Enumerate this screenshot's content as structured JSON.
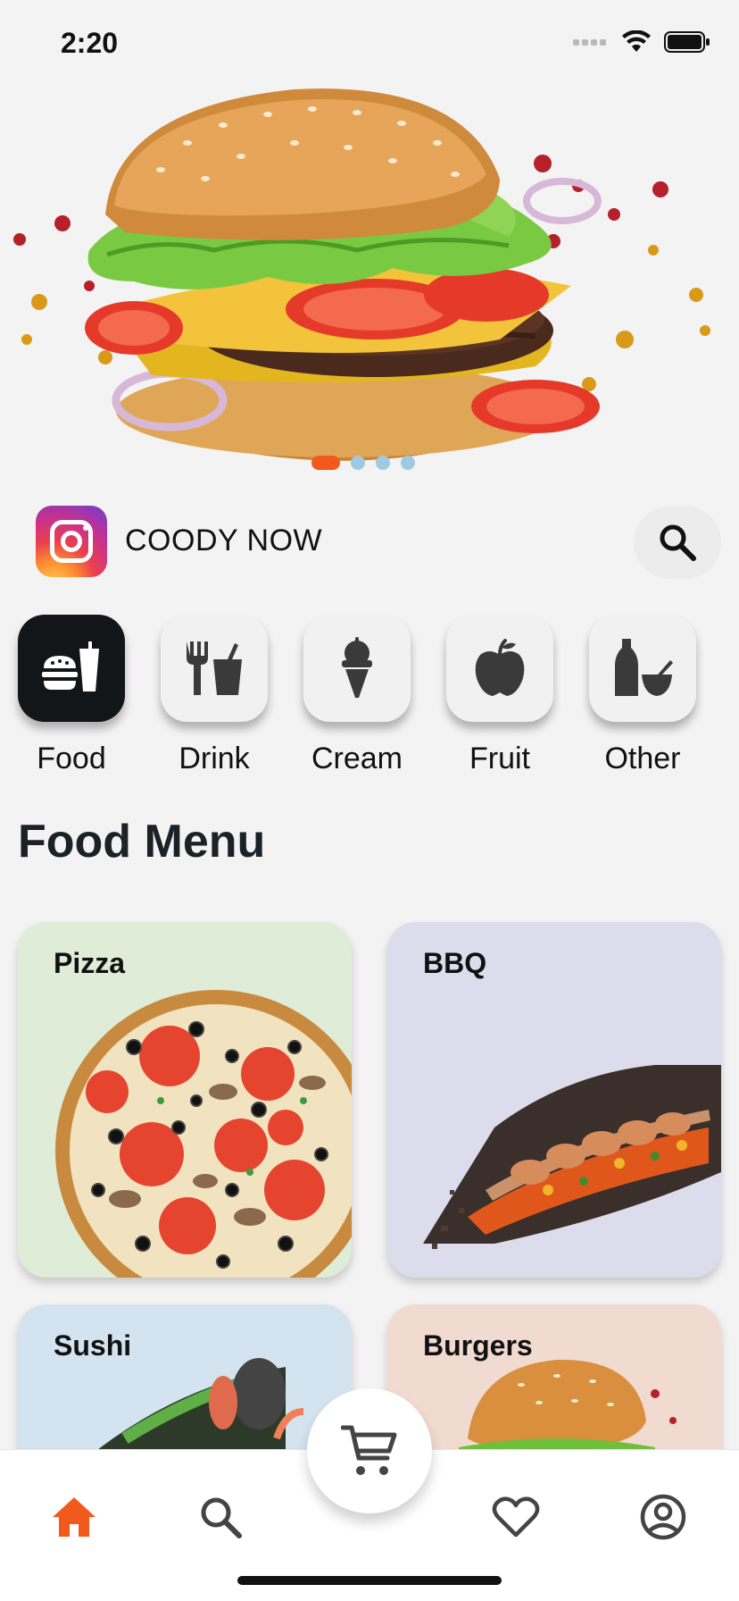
{
  "status_bar": {
    "time": "2:20"
  },
  "hero": {
    "pager_count": 4,
    "active_index": 0
  },
  "brand": {
    "name": "COODY NOW"
  },
  "categories": [
    {
      "label": "Food",
      "icon": "burger-drink-icon",
      "active": true
    },
    {
      "label": "Drink",
      "icon": "fork-drink-icon",
      "active": false
    },
    {
      "label": "Cream",
      "icon": "ice-cream-icon",
      "active": false
    },
    {
      "label": "Fruit",
      "icon": "apple-icon",
      "active": false
    },
    {
      "label": "Other",
      "icon": "bottle-bowl-icon",
      "active": false
    }
  ],
  "section": {
    "title": "Food Menu"
  },
  "menu": [
    {
      "name": "Pizza",
      "bg": "#deecd8"
    },
    {
      "name": "BBQ",
      "bg": "#dddcec"
    },
    {
      "name": "Sushi",
      "bg": "#d3e3ef"
    },
    {
      "name": "Burgers",
      "bg": "#f1dad0"
    }
  ],
  "tab_bar": {
    "items": [
      "home-icon",
      "search-icon",
      "cart-icon",
      "heart-icon",
      "profile-icon"
    ],
    "active": "home-icon",
    "accent": "#f25a1d"
  }
}
